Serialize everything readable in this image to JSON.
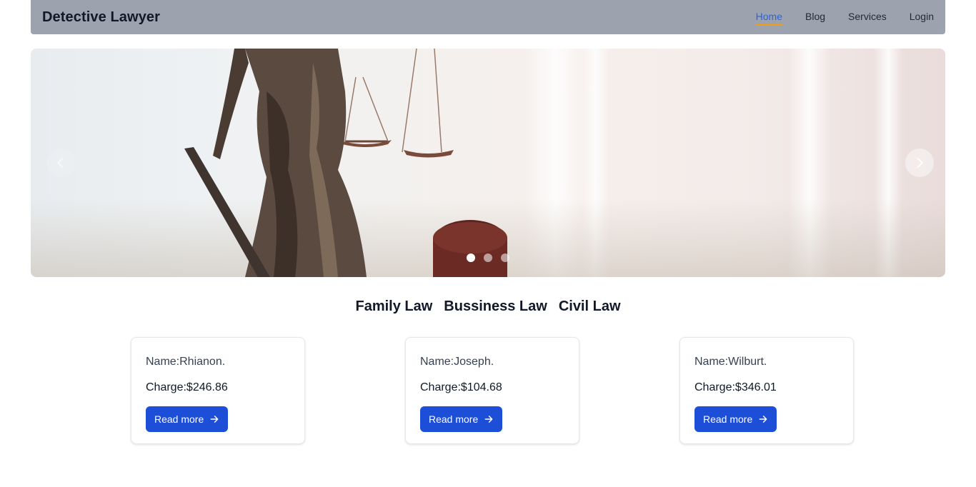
{
  "navbar": {
    "brand": "Detective Lawyer",
    "links": [
      {
        "label": "Home",
        "active": true
      },
      {
        "label": "Blog",
        "active": false
      },
      {
        "label": "Services",
        "active": false
      },
      {
        "label": "Login",
        "active": false
      }
    ]
  },
  "carousel": {
    "slide_count": 3,
    "active_slide": 1,
    "icons": {
      "prev": "chevron-left-icon",
      "next": "chevron-right-icon"
    }
  },
  "categories": [
    "Family Law",
    "Bussiness Law",
    "Civil Law"
  ],
  "cards": [
    {
      "name": "Name:Rhianon.",
      "charge": "Charge:$246.86",
      "button": "Read more"
    },
    {
      "name": "Name:Joseph.",
      "charge": "Charge:$104.68",
      "button": "Read more"
    },
    {
      "name": "Name:Wilburt.",
      "charge": "Charge:$346.01",
      "button": "Read more"
    }
  ],
  "colors": {
    "navbar_bg": "#9ca3af",
    "active_link": "#2563eb",
    "active_underline": "#f59e0b",
    "button_bg": "#1d4ed8"
  }
}
